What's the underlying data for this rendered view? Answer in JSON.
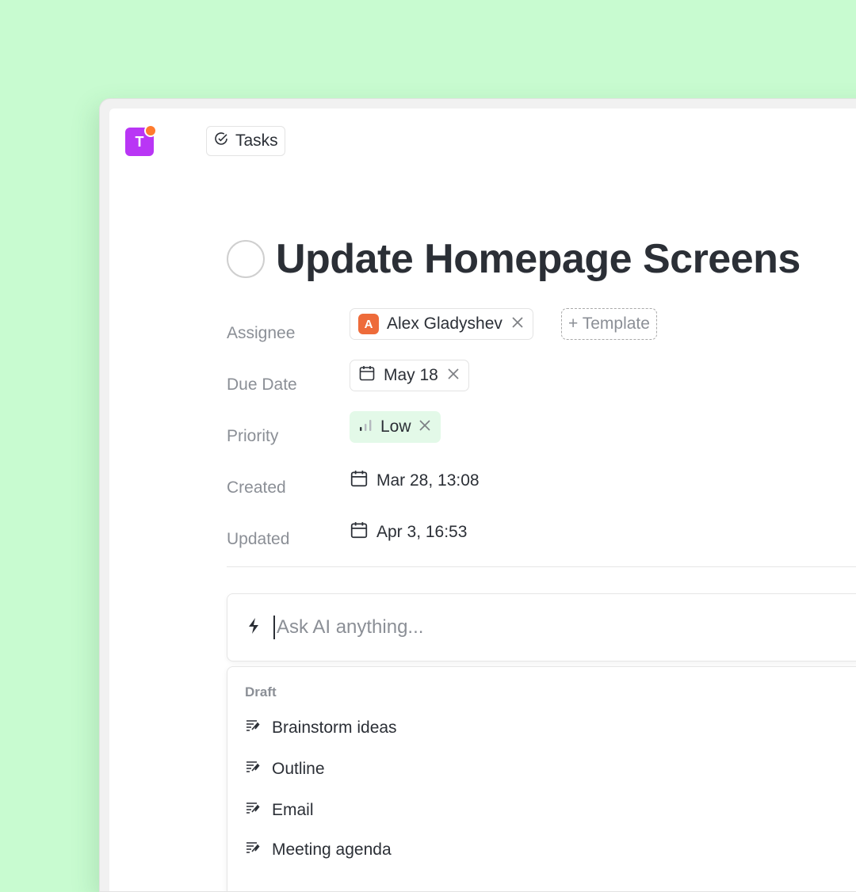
{
  "app": {
    "logo_letter": "T",
    "logo_color": "#b936f5",
    "badge_color": "#ff7b2e"
  },
  "tab": {
    "label": "Tasks",
    "icon": "check-circle-icon"
  },
  "task": {
    "title": "Update Homepage Screens",
    "status": "not-started"
  },
  "properties": {
    "assignee": {
      "label": "Assignee",
      "name": "Alex Gladyshev",
      "avatar_letter": "A",
      "avatar_color": "#ee6b3a",
      "template_label": "+ Template"
    },
    "due_date": {
      "label": "Due Date",
      "value": "May 18"
    },
    "priority": {
      "label": "Priority",
      "value": "Low",
      "color": "#e3f9e8"
    },
    "created": {
      "label": "Created",
      "value": "Mar 28, 13:08"
    },
    "updated": {
      "label": "Updated",
      "value": "Apr 3, 16:53"
    }
  },
  "ai": {
    "placeholder": "Ask AI anything...",
    "icon": "lightning-icon"
  },
  "menu": {
    "section": "Draft",
    "items": [
      {
        "label": "Brainstorm ideas",
        "icon": "draft-pen-icon"
      },
      {
        "label": "Outline",
        "icon": "draft-pen-icon"
      },
      {
        "label": "Email",
        "icon": "draft-pen-icon"
      },
      {
        "label": "Meeting agenda",
        "icon": "draft-pen-icon"
      }
    ]
  }
}
